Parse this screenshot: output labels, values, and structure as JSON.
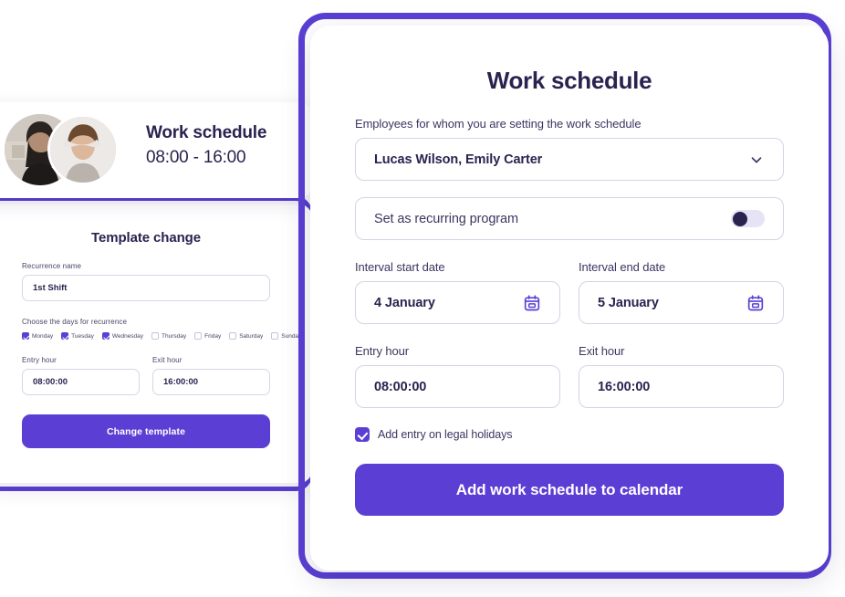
{
  "theme": {
    "accent": "#5b3fd4",
    "ink": "#2a2350",
    "muted": "#3d3660",
    "border": "#d6d2e3",
    "toggle_track": "#e7e3f7"
  },
  "header_card": {
    "title": "Work schedule",
    "subtitle": "08:00 - 16:00",
    "avatars": [
      {
        "name": "avatar-employee-1"
      },
      {
        "name": "avatar-employee-2"
      }
    ]
  },
  "template_card": {
    "title": "Template change",
    "recurrence_name_label": "Recurrence name",
    "recurrence_name_value": "1st Shift",
    "days_label": "Choose the days for recurrence",
    "days": [
      {
        "label": "Monday",
        "checked": true
      },
      {
        "label": "Tuesday",
        "checked": true
      },
      {
        "label": "Wednesday",
        "checked": true
      },
      {
        "label": "Thursday",
        "checked": false
      },
      {
        "label": "Friday",
        "checked": false
      },
      {
        "label": "Saturday",
        "checked": false
      },
      {
        "label": "Sunday",
        "checked": false
      }
    ],
    "entry_hour_label": "Entry hour",
    "entry_hour_value": "08:00:00",
    "exit_hour_label": "Exit hour",
    "exit_hour_value": "16:00:00",
    "submit_label": "Change template"
  },
  "schedule_card": {
    "title": "Work schedule",
    "employees_label": "Employees for whom you are setting the work schedule",
    "employees_value": "Lucas Wilson, Emily Carter",
    "employees_icon": "chevron-down-icon",
    "recurring_label": "Set as recurring program",
    "recurring_on": false,
    "start_date_label": "Interval start date",
    "start_date_value": "4 January",
    "start_date_icon": "calendar-icon",
    "end_date_label": "Interval end date",
    "end_date_value": "5 January",
    "end_date_icon": "calendar-icon",
    "entry_hour_label": "Entry hour",
    "entry_hour_value": "08:00:00",
    "exit_hour_label": "Exit hour",
    "exit_hour_value": "16:00:00",
    "legal_holidays_label": "Add entry on legal holidays",
    "legal_holidays_checked": true,
    "submit_label": "Add work schedule to calendar"
  }
}
